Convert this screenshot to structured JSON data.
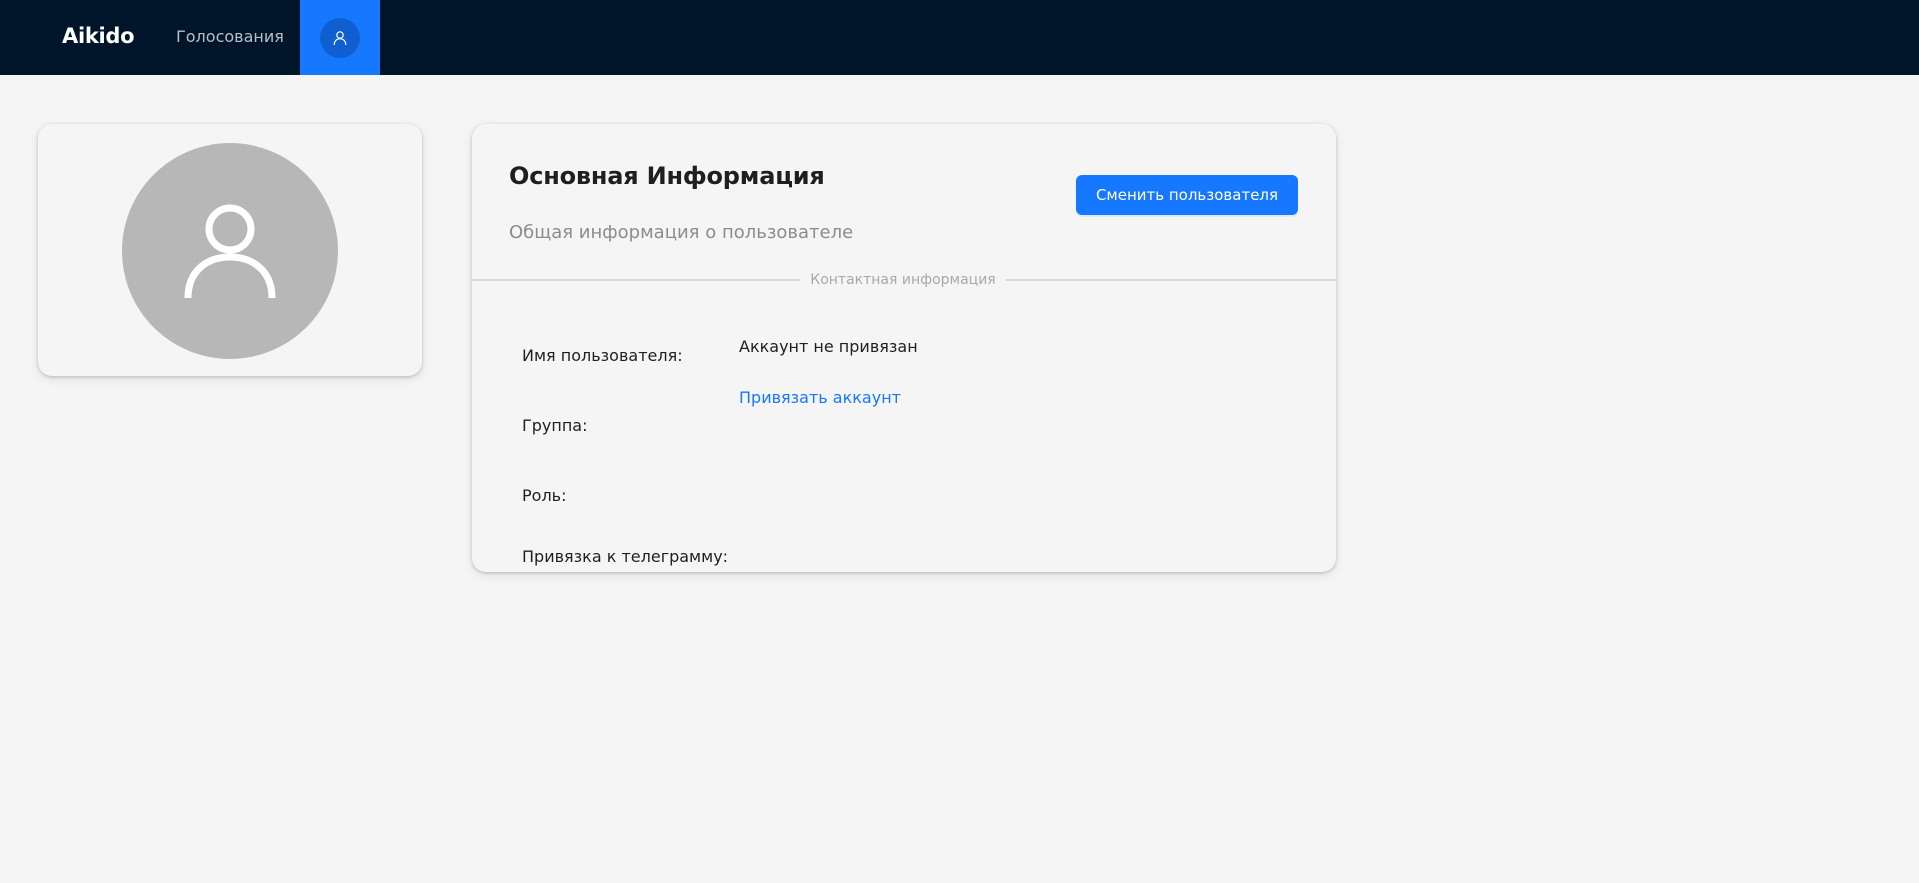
{
  "navbar": {
    "brand": "Aikido",
    "links": [
      {
        "label": "Голосования"
      }
    ],
    "active_item": "profile",
    "icons": {
      "profile": "user-icon"
    }
  },
  "avatar_card": {
    "icon": "user-icon"
  },
  "info_card": {
    "title": "Основная Информация",
    "subtitle": "Общая информация о пользователе",
    "switch_button_label": "Сменить пользователя",
    "divider_label": "Контактная информация",
    "fields": [
      {
        "label": "Имя пользователя:",
        "value": "Аккаунт не привязан"
      },
      {
        "label": "Группа:",
        "value": ""
      },
      {
        "label": "Роль:",
        "value": ""
      },
      {
        "label": "Привязка к телеграмму:",
        "value": ""
      }
    ],
    "bind_link_label": "Привязать аккаунт"
  },
  "colors": {
    "navbar_bg": "#001529",
    "accent": "#1677ff",
    "page_bg": "#f5f5f5",
    "avatar_bg": "#b7b7b7",
    "muted_text": "#8c8c8c"
  }
}
